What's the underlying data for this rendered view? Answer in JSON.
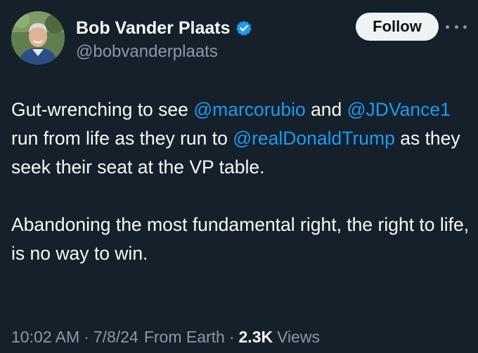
{
  "author": {
    "display_name": "Bob Vander Plaats",
    "handle": "@bobvanderplaats",
    "verified": true
  },
  "follow_label": "Follow",
  "more_icon": "more-horizontal-icon",
  "tweet": {
    "paragraph1": {
      "t1": "Gut-wrenching to see ",
      "m1": "@marcorubio",
      "t2": " and ",
      "m2": "@JDVance1",
      "t3": " run from life as they run to ",
      "m3": "@realDonaldTrump",
      "t4": " as they seek their seat at the VP table."
    },
    "paragraph2": "Abandoning the most fundamental right, the right to life, is no way to win."
  },
  "meta": {
    "time": "10:02 AM",
    "separator": "·",
    "date": "7/8/24",
    "source": "From Earth",
    "views_count": "2.3K",
    "views_label": "Views"
  },
  "colors": {
    "background": "#15202b",
    "text": "#f7f9f9",
    "muted": "#8b98a5",
    "link": "#1d9bf0",
    "verified_badge": "#1d9bf0",
    "follow_bg": "#eff3f4"
  }
}
